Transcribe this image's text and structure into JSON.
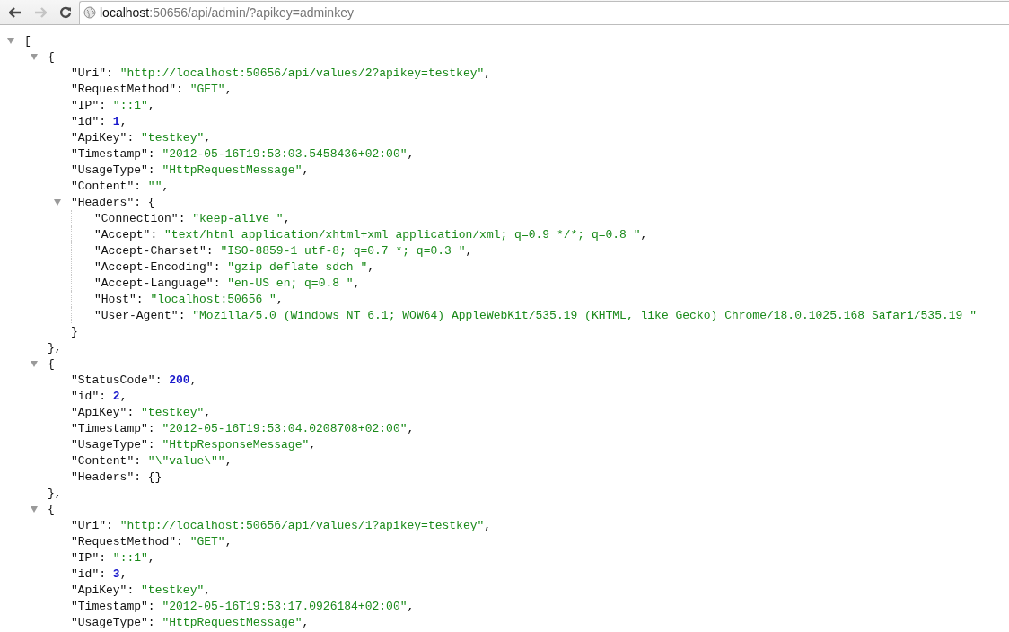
{
  "toolbar": {
    "buttons": [
      {
        "kind": "back",
        "disabled": false
      },
      {
        "kind": "forward",
        "disabled": true
      },
      {
        "kind": "reload",
        "disabled": false
      }
    ],
    "address": {
      "host": "localhost",
      "rest": ":50656/api/admin/?apikey=adminkey"
    }
  },
  "tree": {
    "tokens": [
      {
        "kind": "punct",
        "text": "["
      }
    ],
    "expanded": true,
    "children": [
      {
        "tokens": [
          {
            "kind": "punct",
            "text": "{"
          }
        ],
        "expanded": true,
        "children": [
          {
            "tokens": [
              {
                "kind": "key",
                "text": "\"Uri\""
              },
              {
                "kind": "punct",
                "text": ": "
              },
              {
                "kind": "string",
                "text": "\"http://localhost:50656/api/values/2?apikey=testkey\""
              },
              {
                "kind": "punct",
                "text": ","
              }
            ]
          },
          {
            "tokens": [
              {
                "kind": "key",
                "text": "\"RequestMethod\""
              },
              {
                "kind": "punct",
                "text": ": "
              },
              {
                "kind": "string",
                "text": "\"GET\""
              },
              {
                "kind": "punct",
                "text": ","
              }
            ]
          },
          {
            "tokens": [
              {
                "kind": "key",
                "text": "\"IP\""
              },
              {
                "kind": "punct",
                "text": ": "
              },
              {
                "kind": "string",
                "text": "\"::1\""
              },
              {
                "kind": "punct",
                "text": ","
              }
            ]
          },
          {
            "tokens": [
              {
                "kind": "key",
                "text": "\"id\""
              },
              {
                "kind": "punct",
                "text": ": "
              },
              {
                "kind": "number",
                "text": "1"
              },
              {
                "kind": "punct",
                "text": ","
              }
            ]
          },
          {
            "tokens": [
              {
                "kind": "key",
                "text": "\"ApiKey\""
              },
              {
                "kind": "punct",
                "text": ": "
              },
              {
                "kind": "string",
                "text": "\"testkey\""
              },
              {
                "kind": "punct",
                "text": ","
              }
            ]
          },
          {
            "tokens": [
              {
                "kind": "key",
                "text": "\"Timestamp\""
              },
              {
                "kind": "punct",
                "text": ": "
              },
              {
                "kind": "string",
                "text": "\"2012-05-16T19:53:03.5458436+02:00\""
              },
              {
                "kind": "punct",
                "text": ","
              }
            ]
          },
          {
            "tokens": [
              {
                "kind": "key",
                "text": "\"UsageType\""
              },
              {
                "kind": "punct",
                "text": ": "
              },
              {
                "kind": "string",
                "text": "\"HttpRequestMessage\""
              },
              {
                "kind": "punct",
                "text": ","
              }
            ]
          },
          {
            "tokens": [
              {
                "kind": "key",
                "text": "\"Content\""
              },
              {
                "kind": "punct",
                "text": ": "
              },
              {
                "kind": "string",
                "text": "\"\""
              },
              {
                "kind": "punct",
                "text": ","
              }
            ]
          },
          {
            "tokens": [
              {
                "kind": "key",
                "text": "\"Headers\""
              },
              {
                "kind": "punct",
                "text": ": {"
              }
            ],
            "expanded": true,
            "children": [
              {
                "tokens": [
                  {
                    "kind": "key",
                    "text": "\"Connection\""
                  },
                  {
                    "kind": "punct",
                    "text": ": "
                  },
                  {
                    "kind": "string",
                    "text": "\"keep-alive \""
                  },
                  {
                    "kind": "punct",
                    "text": ","
                  }
                ]
              },
              {
                "tokens": [
                  {
                    "kind": "key",
                    "text": "\"Accept\""
                  },
                  {
                    "kind": "punct",
                    "text": ": "
                  },
                  {
                    "kind": "string",
                    "text": "\"text/html application/xhtml+xml application/xml; q=0.9 */*; q=0.8 \""
                  },
                  {
                    "kind": "punct",
                    "text": ","
                  }
                ]
              },
              {
                "tokens": [
                  {
                    "kind": "key",
                    "text": "\"Accept-Charset\""
                  },
                  {
                    "kind": "punct",
                    "text": ": "
                  },
                  {
                    "kind": "string",
                    "text": "\"ISO-8859-1 utf-8; q=0.7 *; q=0.3 \""
                  },
                  {
                    "kind": "punct",
                    "text": ","
                  }
                ]
              },
              {
                "tokens": [
                  {
                    "kind": "key",
                    "text": "\"Accept-Encoding\""
                  },
                  {
                    "kind": "punct",
                    "text": ": "
                  },
                  {
                    "kind": "string",
                    "text": "\"gzip deflate sdch \""
                  },
                  {
                    "kind": "punct",
                    "text": ","
                  }
                ]
              },
              {
                "tokens": [
                  {
                    "kind": "key",
                    "text": "\"Accept-Language\""
                  },
                  {
                    "kind": "punct",
                    "text": ": "
                  },
                  {
                    "kind": "string",
                    "text": "\"en-US en; q=0.8 \""
                  },
                  {
                    "kind": "punct",
                    "text": ","
                  }
                ]
              },
              {
                "tokens": [
                  {
                    "kind": "key",
                    "text": "\"Host\""
                  },
                  {
                    "kind": "punct",
                    "text": ": "
                  },
                  {
                    "kind": "string",
                    "text": "\"localhost:50656 \""
                  },
                  {
                    "kind": "punct",
                    "text": ","
                  }
                ]
              },
              {
                "tokens": [
                  {
                    "kind": "key",
                    "text": "\"User-Agent\""
                  },
                  {
                    "kind": "punct",
                    "text": ": "
                  },
                  {
                    "kind": "string",
                    "text": "\"Mozilla/5.0 (Windows NT 6.1; WOW64) AppleWebKit/535.19 (KHTML, like Gecko) Chrome/18.0.1025.168 Safari/535.19 \""
                  }
                ]
              }
            ],
            "close": [
              {
                "kind": "punct",
                "text": "}"
              }
            ]
          }
        ],
        "close": [
          {
            "kind": "punct",
            "text": "},"
          }
        ]
      },
      {
        "tokens": [
          {
            "kind": "punct",
            "text": "{"
          }
        ],
        "expanded": true,
        "children": [
          {
            "tokens": [
              {
                "kind": "key",
                "text": "\"StatusCode\""
              },
              {
                "kind": "punct",
                "text": ": "
              },
              {
                "kind": "number",
                "text": "200"
              },
              {
                "kind": "punct",
                "text": ","
              }
            ]
          },
          {
            "tokens": [
              {
                "kind": "key",
                "text": "\"id\""
              },
              {
                "kind": "punct",
                "text": ": "
              },
              {
                "kind": "number",
                "text": "2"
              },
              {
                "kind": "punct",
                "text": ","
              }
            ]
          },
          {
            "tokens": [
              {
                "kind": "key",
                "text": "\"ApiKey\""
              },
              {
                "kind": "punct",
                "text": ": "
              },
              {
                "kind": "string",
                "text": "\"testkey\""
              },
              {
                "kind": "punct",
                "text": ","
              }
            ]
          },
          {
            "tokens": [
              {
                "kind": "key",
                "text": "\"Timestamp\""
              },
              {
                "kind": "punct",
                "text": ": "
              },
              {
                "kind": "string",
                "text": "\"2012-05-16T19:53:04.0208708+02:00\""
              },
              {
                "kind": "punct",
                "text": ","
              }
            ]
          },
          {
            "tokens": [
              {
                "kind": "key",
                "text": "\"UsageType\""
              },
              {
                "kind": "punct",
                "text": ": "
              },
              {
                "kind": "string",
                "text": "\"HttpResponseMessage\""
              },
              {
                "kind": "punct",
                "text": ","
              }
            ]
          },
          {
            "tokens": [
              {
                "kind": "key",
                "text": "\"Content\""
              },
              {
                "kind": "punct",
                "text": ": "
              },
              {
                "kind": "string",
                "text": "\"\\\"value\\\"\""
              },
              {
                "kind": "punct",
                "text": ","
              }
            ]
          },
          {
            "tokens": [
              {
                "kind": "key",
                "text": "\"Headers\""
              },
              {
                "kind": "punct",
                "text": ": {}"
              }
            ]
          }
        ],
        "close": [
          {
            "kind": "punct",
            "text": "},"
          }
        ]
      },
      {
        "tokens": [
          {
            "kind": "punct",
            "text": "{"
          }
        ],
        "expanded": true,
        "children": [
          {
            "tokens": [
              {
                "kind": "key",
                "text": "\"Uri\""
              },
              {
                "kind": "punct",
                "text": ": "
              },
              {
                "kind": "string",
                "text": "\"http://localhost:50656/api/values/1?apikey=testkey\""
              },
              {
                "kind": "punct",
                "text": ","
              }
            ]
          },
          {
            "tokens": [
              {
                "kind": "key",
                "text": "\"RequestMethod\""
              },
              {
                "kind": "punct",
                "text": ": "
              },
              {
                "kind": "string",
                "text": "\"GET\""
              },
              {
                "kind": "punct",
                "text": ","
              }
            ]
          },
          {
            "tokens": [
              {
                "kind": "key",
                "text": "\"IP\""
              },
              {
                "kind": "punct",
                "text": ": "
              },
              {
                "kind": "string",
                "text": "\"::1\""
              },
              {
                "kind": "punct",
                "text": ","
              }
            ]
          },
          {
            "tokens": [
              {
                "kind": "key",
                "text": "\"id\""
              },
              {
                "kind": "punct",
                "text": ": "
              },
              {
                "kind": "number",
                "text": "3"
              },
              {
                "kind": "punct",
                "text": ","
              }
            ]
          },
          {
            "tokens": [
              {
                "kind": "key",
                "text": "\"ApiKey\""
              },
              {
                "kind": "punct",
                "text": ": "
              },
              {
                "kind": "string",
                "text": "\"testkey\""
              },
              {
                "kind": "punct",
                "text": ","
              }
            ]
          },
          {
            "tokens": [
              {
                "kind": "key",
                "text": "\"Timestamp\""
              },
              {
                "kind": "punct",
                "text": ": "
              },
              {
                "kind": "string",
                "text": "\"2012-05-16T19:53:17.0926184+02:00\""
              },
              {
                "kind": "punct",
                "text": ","
              }
            ]
          },
          {
            "tokens": [
              {
                "kind": "key",
                "text": "\"UsageType\""
              },
              {
                "kind": "punct",
                "text": ": "
              },
              {
                "kind": "string",
                "text": "\"HttpRequestMessage\""
              },
              {
                "kind": "punct",
                "text": ","
              }
            ]
          }
        ]
      }
    ]
  }
}
